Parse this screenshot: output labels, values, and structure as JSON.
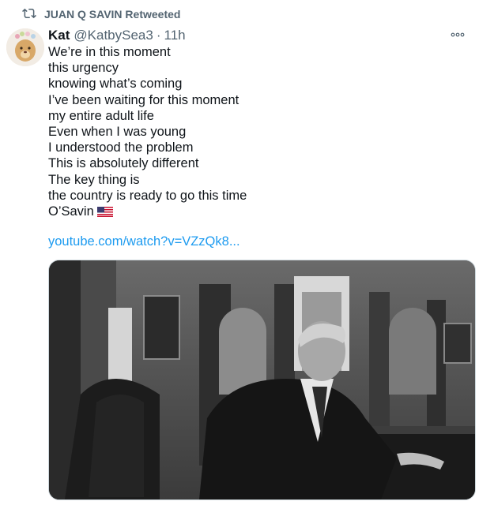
{
  "retweet": {
    "icon": "retweet-icon",
    "label": "JUAN Q SAVIN Retweeted"
  },
  "tweet": {
    "author_name": "Kat",
    "author_handle": "@KatbySea3",
    "separator": "·",
    "time": "11h",
    "more_icon": "more-options-icon",
    "lines": [
      "We’re in this moment",
      "this urgency",
      "knowing what’s coming",
      "I’ve been waiting for this moment",
      "my entire adult life",
      "Even when I was young",
      "I understood the problem",
      "This is absolutely different",
      "The key thing is",
      "the country is ready to go this time",
      "O’Savin"
    ],
    "flag_icon": "us-flag-icon",
    "link": "youtube.com/watch?v=VZzQk8...",
    "media_icon": "photo-image"
  },
  "colors": {
    "text": "#0f1419",
    "secondary": "#536471",
    "link": "#1d9bf0",
    "border": "#cfd9de"
  }
}
